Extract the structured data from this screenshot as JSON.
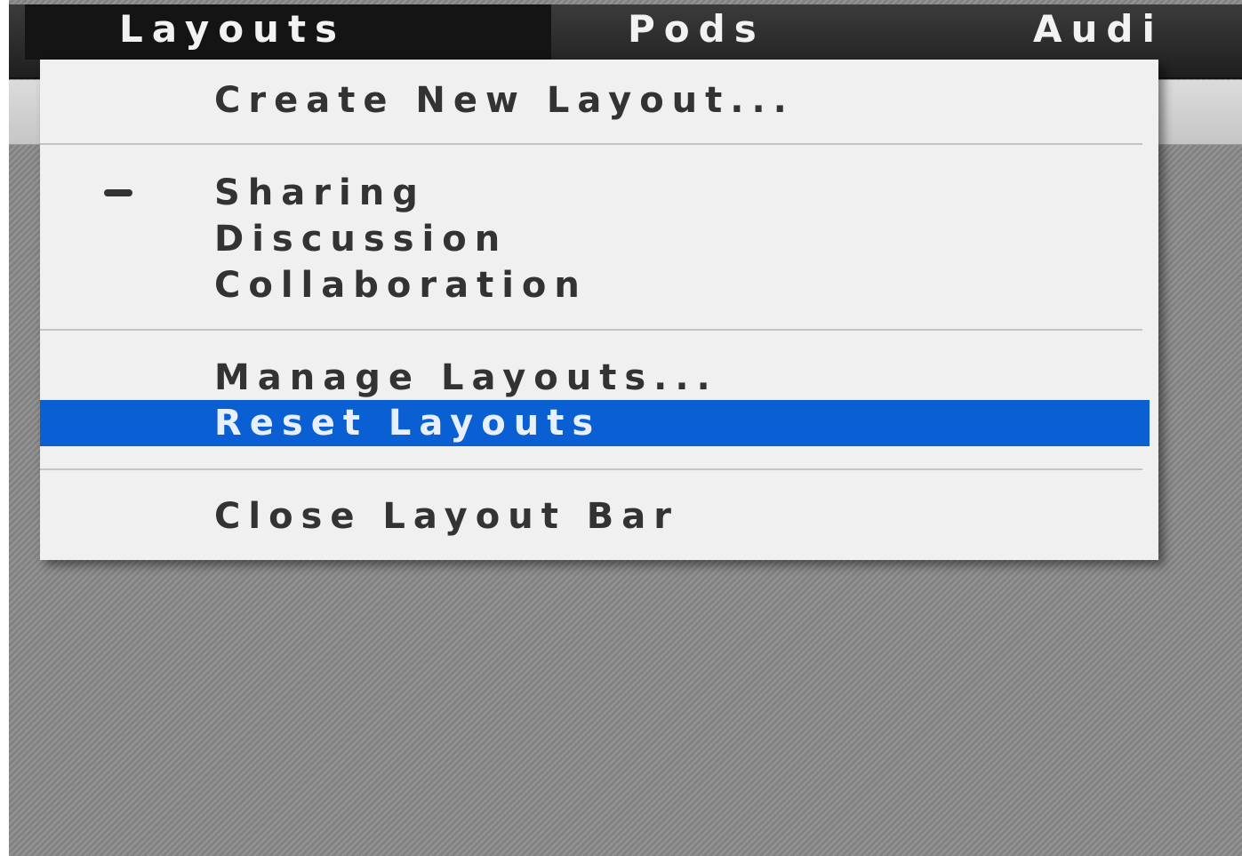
{
  "menubar": {
    "items": [
      {
        "label": "Layouts",
        "active": true
      },
      {
        "label": "Pods",
        "active": false
      },
      {
        "label": "Audi",
        "active": false
      }
    ]
  },
  "dropdown": {
    "create_label": "Create New Layout...",
    "layouts": [
      {
        "label": "Sharing",
        "selected": true
      },
      {
        "label": "Discussion",
        "selected": false
      },
      {
        "label": "Collaboration",
        "selected": false
      }
    ],
    "manage_label": "Manage Layouts...",
    "reset_label": "Reset Layouts",
    "close_label": "Close Layout Bar",
    "highlighted_item": "Reset Layouts"
  },
  "colors": {
    "menubar_bg": "#2a2a2a",
    "menu_bg": "#f0f0f0",
    "highlight": "#0a5fd3",
    "text": "#333333"
  }
}
